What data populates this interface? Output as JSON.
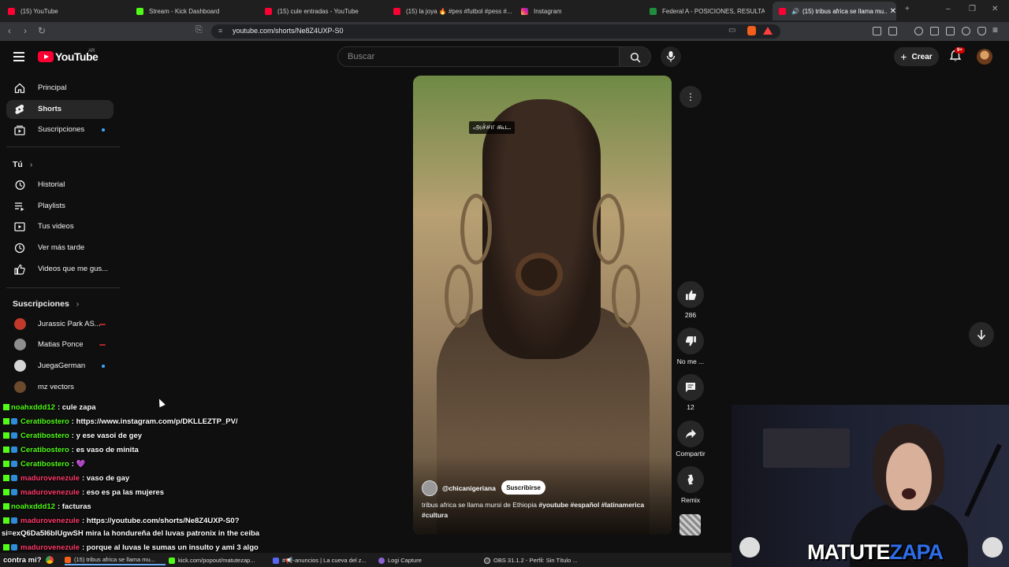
{
  "browser": {
    "tabs": [
      {
        "label": "(15) YouTube",
        "favicon": "youtube-icon"
      },
      {
        "label": "Stream - Kick Dashboard",
        "favicon": "kick-icon"
      },
      {
        "label": "(15) cule entradas - YouTube",
        "favicon": "youtube-icon"
      },
      {
        "label": "(15) la joya 🔥 #pes #futbol #pess #...",
        "favicon": "youtube-icon"
      },
      {
        "label": "Instagram",
        "favicon": "instagram-icon"
      },
      {
        "label": "Federal A - POSICIONES, RESULTADOS",
        "favicon": "globe-icon"
      },
      {
        "label": "(15) tribus africa se llama mu...",
        "favicon": "youtube-icon"
      }
    ],
    "url": "youtube.com/shorts/Ne8Z4UXP-S0"
  },
  "youtube": {
    "logo_text": "YouTube",
    "country": "AR",
    "search_placeholder": "Buscar",
    "create_label": "Crear",
    "notifications_badge": "9+"
  },
  "sidebar": {
    "top_items": [
      {
        "label": "Principal",
        "icon": "home-icon"
      },
      {
        "label": "Shorts",
        "icon": "shorts-icon"
      },
      {
        "label": "Suscripciones",
        "icon": "subscriptions-icon"
      }
    ],
    "you_header": "Tú",
    "you_items": [
      {
        "label": "Historial",
        "icon": "history-icon"
      },
      {
        "label": "Playlists",
        "icon": "playlists-icon"
      },
      {
        "label": "Tus videos",
        "icon": "your-videos-icon"
      },
      {
        "label": "Ver más tarde",
        "icon": "watch-later-icon"
      },
      {
        "label": "Videos que me gus...",
        "icon": "liked-videos-icon"
      }
    ],
    "subs_header": "Suscripciones",
    "subscriptions": [
      {
        "label": "Jurassic Park AS...",
        "avatar_color": "#c0392b"
      },
      {
        "label": "Matias Ponce",
        "avatar_color": "#8e8e8e"
      },
      {
        "label": "JuegaGerman",
        "avatar_color": "#d6d6d6"
      },
      {
        "label": "mz vectors",
        "avatar_color": "#6b4a2e"
      }
    ]
  },
  "short": {
    "caption_overlay": "அச்சா கூட",
    "channel_handle": "@chicanigeriana",
    "subscribe_label": "Suscribirse",
    "description": "tribus africa se llama mursi de Ethiopia",
    "hashtags": "#youtube #español #latinamerica #cultura",
    "likes": "286",
    "dislike_label": "No me ...",
    "comments": "12",
    "share_label": "Compartir",
    "remix_label": "Remix"
  },
  "chat": [
    {
      "user": "noahxddd12",
      "msg": ": cule zapa",
      "color": "#53fc18"
    },
    {
      "user": "Ceratibostero",
      "msg": ": https://www.instagram.com/p/DKLLEZTP_PV/",
      "color": "#53fc18"
    },
    {
      "user": "Ceratibostero",
      "msg": ": y ese vasoi de gey",
      "color": "#53fc18"
    },
    {
      "user": "Ceratibostero",
      "msg": ": es vaso de minita",
      "color": "#53fc18"
    },
    {
      "user": "Ceratibostero",
      "msg": ": 💜",
      "color": "#53fc18"
    },
    {
      "user": "madurovenezule",
      "msg": ": vaso de gay",
      "color": "#ff3b6b"
    },
    {
      "user": "madurovenezule",
      "msg": ": eso es pa las mujeres",
      "color": "#ff3b6b"
    },
    {
      "user": "noahxddd12",
      "msg": ": facturas",
      "color": "#53fc18"
    },
    {
      "user": "madurovenezule",
      "msg": ": https://youtube.com/shorts/Ne8Z4UXP-S0?",
      "color": "#ff3b6b"
    },
    {
      "user": "",
      "msg": "si=exQ6Da5I6bIUgwSH mira la hondureña del luvas patronix in the ceiba",
      "color": "#ffffff"
    },
    {
      "user": "madurovenezule",
      "msg": ": porque al luvas le sumas un insulto y ami 3 algo",
      "color": "#ff3b6b"
    },
    {
      "user": "",
      "msg": "contra mi?",
      "color": "#ffffff"
    }
  ],
  "taskbar": [
    {
      "label": "(15) tribus africa se llama mu...",
      "favicon": "brave-icon"
    },
    {
      "label": "kick.com/popout/matutezap...",
      "favicon": "kick-icon"
    },
    {
      "label": "#📢-anuncios | La cueva del z...",
      "favicon": "discord-icon"
    },
    {
      "label": "Logi Capture",
      "favicon": "logi-icon"
    },
    {
      "label": "OBS 31.1.2 - Perfil: Sin Título ...",
      "favicon": "obs-icon"
    }
  ],
  "overlay": {
    "streamer_name_a": "MATUTE",
    "streamer_name_b": "ZAPA"
  }
}
